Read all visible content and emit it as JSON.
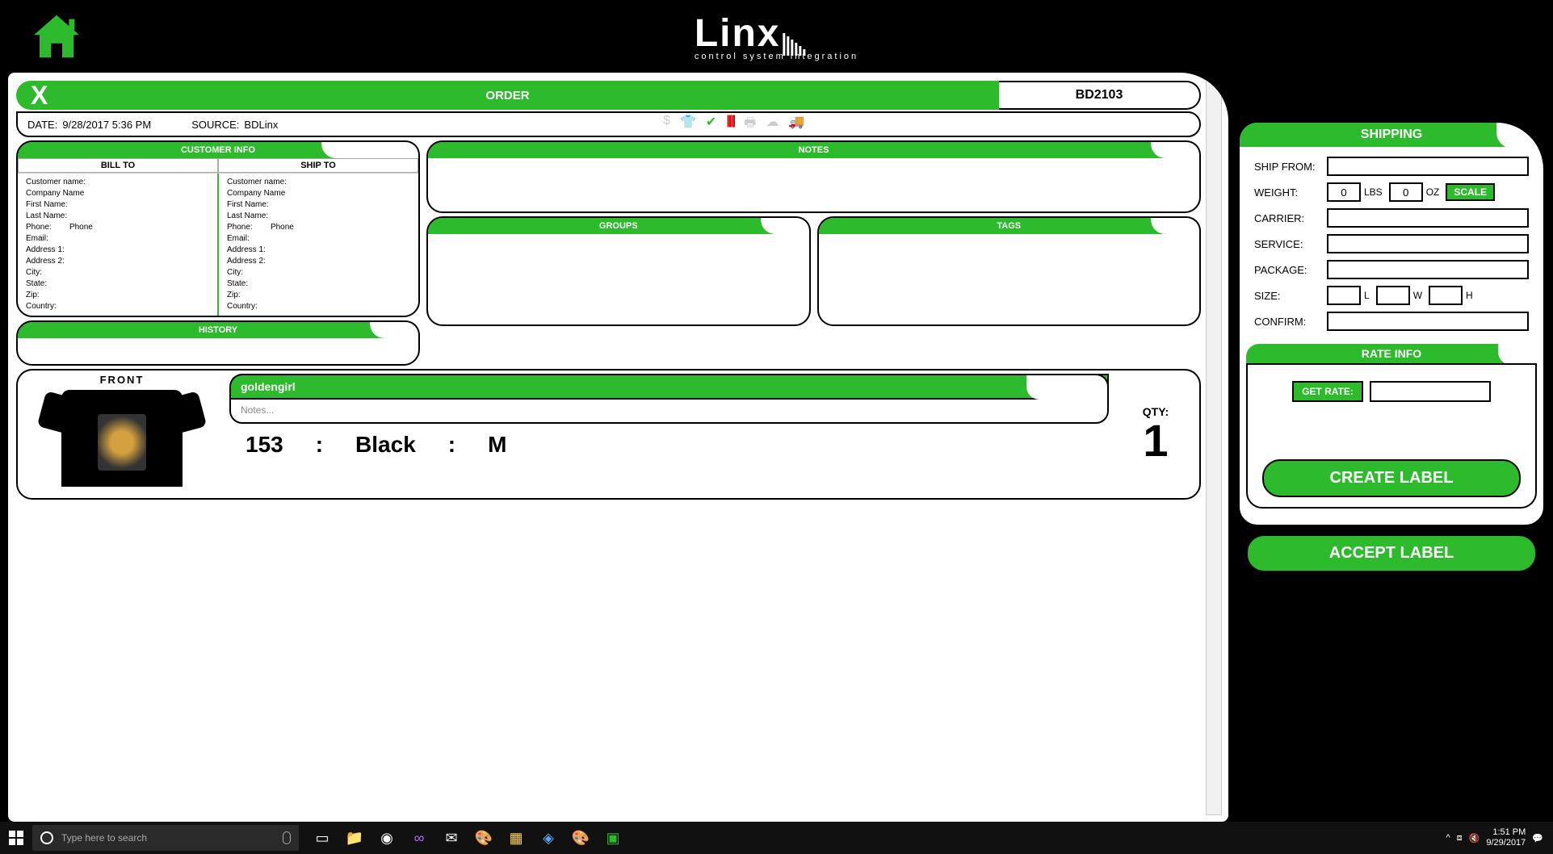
{
  "app": {
    "logo_text": "Linx",
    "logo_sub": "control system integration"
  },
  "order": {
    "header_label": "ORDER",
    "order_id": "BD2103",
    "close_x": "X",
    "date_label": "DATE:",
    "date_value": "9/28/2017 5:36 PM",
    "source_label": "SOURCE:",
    "source_value": "BDLinx"
  },
  "customer_info": {
    "title": "CUSTOMER INFO",
    "bill_to_label": "BILL TO",
    "ship_to_label": "SHIP TO",
    "fields": {
      "customer_name": "Customer name:",
      "company_name": "Company Name",
      "first_name": "First Name:",
      "last_name": "Last Name:",
      "phone": "Phone:",
      "phone_val": "Phone",
      "email": "Email:",
      "address1": "Address 1:",
      "address2": "Address 2:",
      "city": "City:",
      "state": "State:",
      "zip": "Zip:",
      "country": "Country:"
    }
  },
  "history": {
    "title": "HISTORY"
  },
  "notes_panel": {
    "title": "NOTES"
  },
  "groups_panel": {
    "title": "GROUPS"
  },
  "tags_panel": {
    "title": "TAGS"
  },
  "product": {
    "view_label": "FRONT",
    "name": "goldengirl",
    "notes_placeholder": "Notes...",
    "sku": "153",
    "color": "Black",
    "size": "M",
    "qty_label": "QTY:",
    "qty": "1",
    "sep": ":"
  },
  "shipping": {
    "title": "SHIPPING",
    "ship_from_label": "SHIP FROM:",
    "ship_from": "",
    "weight_label": "WEIGHT:",
    "weight_lbs": "0",
    "lbs_unit": "LBS",
    "weight_oz": "0",
    "oz_unit": "OZ",
    "scale_btn": "SCALE",
    "carrier_label": "CARRIER:",
    "carrier": "",
    "service_label": "SERVICE:",
    "service": "",
    "package_label": "PACKAGE:",
    "package": "",
    "size_label": "SIZE:",
    "size_l": "",
    "size_l_unit": "L",
    "size_w": "",
    "size_w_unit": "W",
    "size_h": "",
    "size_h_unit": "H",
    "confirm_label": "CONFIRM:",
    "confirm": ""
  },
  "rate": {
    "title": "RATE INFO",
    "get_rate_btn": "GET RATE:",
    "rate_value": "",
    "create_label_btn": "CREATE LABEL",
    "accept_label_btn": "ACCEPT LABEL"
  },
  "taskbar": {
    "search_placeholder": "Type here to search",
    "time": "1:51 PM",
    "date": "9/29/2017"
  }
}
